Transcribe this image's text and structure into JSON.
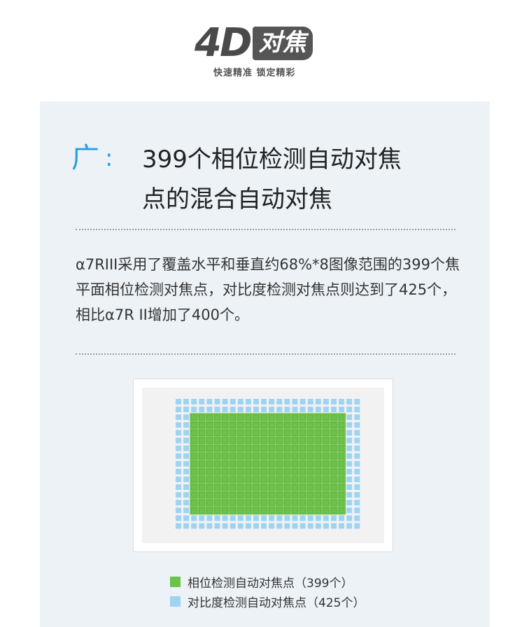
{
  "logo": {
    "mark": "4D",
    "badge": "对焦",
    "tagline": "快速精准 锁定精彩"
  },
  "section": {
    "marker": "广",
    "colon": ":",
    "heading_line1": "399个相位检测自动对焦",
    "heading_line2": "点的混合自动对焦",
    "description": "α7RIII采用了覆盖水平和垂直约68%*8图像范围的399个焦平面相位检测对焦点，对比度检测对焦点则达到了425个，相比α7R II增加了400个。"
  },
  "legend": {
    "phase_label": "相位检测自动对焦点（399个）",
    "contrast_label": "对比度检测自动对焦点（425个）"
  },
  "colors": {
    "accent": "#2a9fe0",
    "phase_detect": "#6cc24a",
    "contrast_detect": "#9fd3f2",
    "panel_bg": "#edf2f6"
  }
}
